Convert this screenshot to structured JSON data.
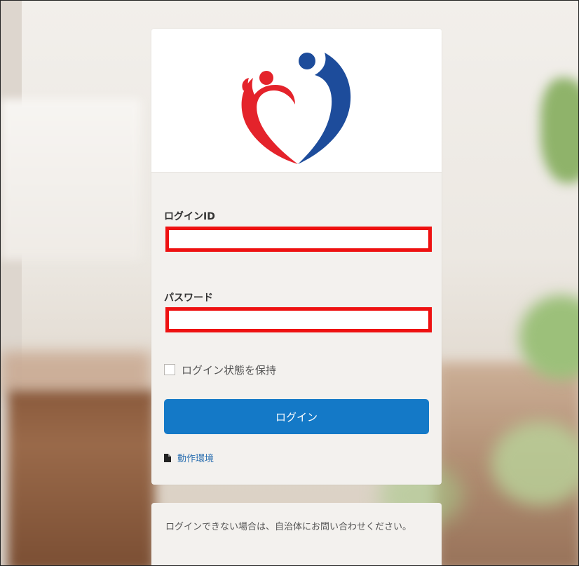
{
  "login": {
    "id_label": "ログインID",
    "id_value": "",
    "password_label": "パスワード",
    "password_value": "",
    "remember_label": "ログイン状態を保持",
    "remember_checked": false,
    "submit_label": "ログイン"
  },
  "links": {
    "environment_label": "動作環境"
  },
  "notice": {
    "text": "ログインできない場合は、自治体にお問い合わせください。"
  },
  "colors": {
    "logo_red": "#e4232b",
    "logo_blue": "#1d4c9b",
    "button": "#1479c7",
    "highlight_border": "#ee1111"
  },
  "icons": {
    "logo": "heart-people-logo",
    "environment": "document-icon"
  }
}
